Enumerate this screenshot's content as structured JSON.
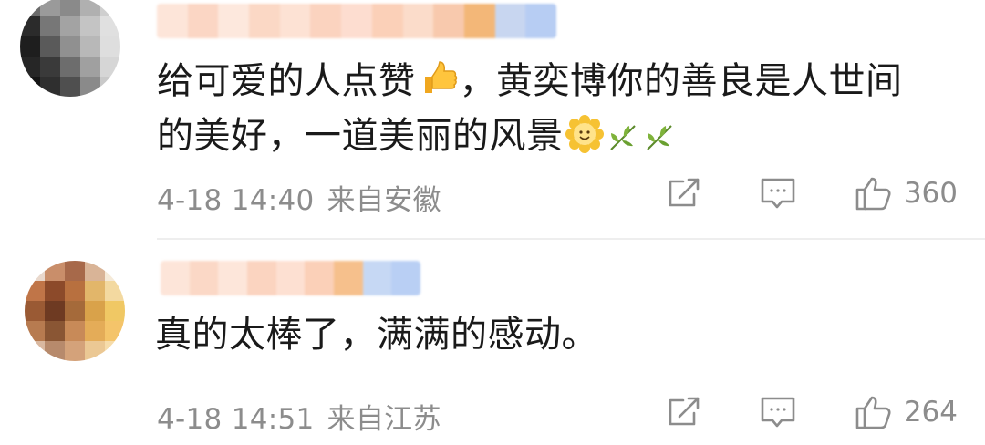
{
  "comments": [
    {
      "text_line1": "给可爱的人点赞",
      "text_line1b": "，黄奕博你的善良是人世间",
      "text_line2": "的美好，一道美丽的风景",
      "date": "4-18 14:40",
      "location": "来自安徽",
      "likes": "360",
      "emojis": [
        "thumbs-up-emoji",
        "sun-flower-emoji",
        "leaf-emoji",
        "leaf-emoji"
      ]
    },
    {
      "text": "真的太棒了，满满的感动。",
      "date": "4-18 14:51",
      "location": "来自江苏",
      "likes": "264"
    }
  ],
  "icons": {
    "share": "share-icon",
    "comment": "comment-icon",
    "like": "like-icon"
  },
  "colors": {
    "text": "#1a1a1a",
    "meta": "#8c8c8c",
    "divider": "#eeeeee"
  }
}
